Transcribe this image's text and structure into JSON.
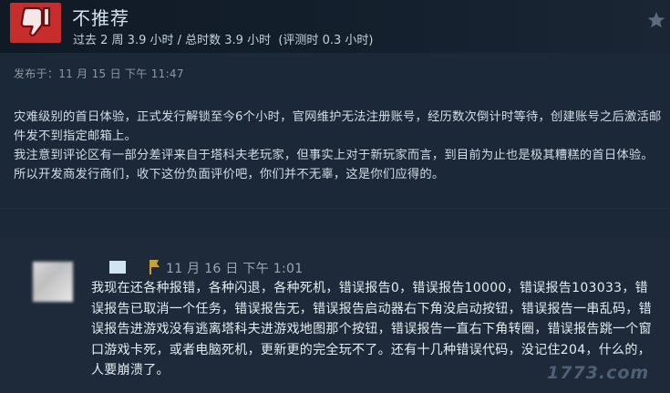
{
  "review": {
    "verdict": "不推荐",
    "hours_past": "过去 2 周 3.9 小时",
    "hours_sep": " / ",
    "hours_total": "总时数 3.9 小时",
    "hours_review": "(评测时 0.3 小时)",
    "posted": "发布于：11 月 15 日 下午 11:47",
    "paragraphs": [
      "灾难级别的首日体验，正式发行解锁至今6个小时，官网维护无法注册账号，经历数次倒计时等待，创建账号之后激活邮件发不到指定邮箱上。",
      "我注意到评论区有一部分差评来自于塔科夫老玩家，但事实上对于新玩家而言，到目前为止也是极其糟糕的首日体验。所以开发商发行商们，收下这份负面评价吧，你们并不无辜，这是你们应得的。"
    ],
    "thumb_color": "#c72d2d",
    "thumb_icon": "thumbs-down-icon",
    "star_icon": "star-icon"
  },
  "comment": {
    "date": "11 月 16 日 下午 1:01",
    "text": "我现在还各种报错，各种闪退，各种死机，错误报告0，错误报告10000，错误报告103033，错误报告已取消一个任务，错误报告无，错误报告启动器右下角没启动按钮，错误报告一串乱码，错误报告进游戏没有逃离塔科夫进游戏地图那个按钮，错误报告一直右下角转圈，错误报告跳一个窗口游戏卡死，或者电脑死机，更新更的完全玩不了。还有十几种错误代码，没记住204，什么的，人要崩溃了。",
    "flag_color": "#c9a033"
  },
  "watermark": "1773.com"
}
